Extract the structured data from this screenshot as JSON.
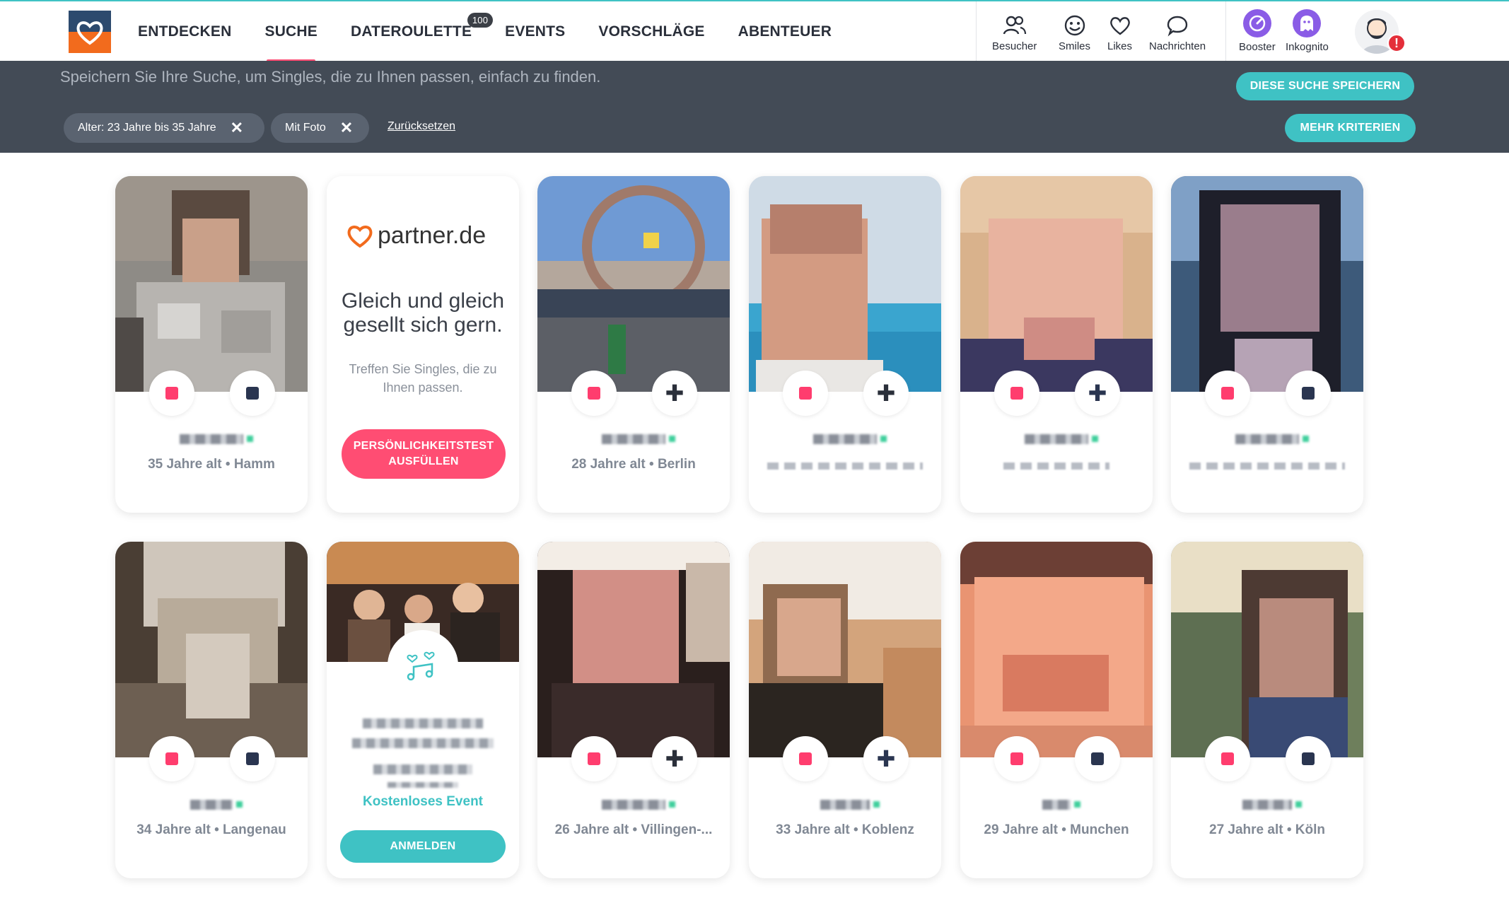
{
  "nav": {
    "items": [
      {
        "label": "ENTDECKEN"
      },
      {
        "label": "SUCHE",
        "active": true
      },
      {
        "label": "DATEROULETTE",
        "badge": "100"
      },
      {
        "label": "EVENTS"
      },
      {
        "label": "VORSCHLÄGE"
      },
      {
        "label": "ABENTEUER"
      }
    ],
    "icons": [
      {
        "label": "Besucher",
        "icon": "visitors-icon"
      },
      {
        "label": "Smiles",
        "icon": "smile-icon"
      },
      {
        "label": "Likes",
        "icon": "heart-outline-icon"
      },
      {
        "label": "Nachrichten",
        "icon": "chat-bubble-icon"
      },
      {
        "label": "Booster",
        "icon": "booster-icon"
      },
      {
        "label": "Inkognito",
        "icon": "ghost-icon"
      }
    ],
    "alert": "!"
  },
  "search": {
    "hint": "Speichern Sie Ihre Suche, um Singles, die zu Ihnen passen, einfach zu finden.",
    "save_label": "DIESE SUCHE SPEICHERN",
    "more_label": "MEHR KRITERIEN",
    "chips": [
      {
        "label": "Alter: 23 Jahre bis 35 Jahre"
      },
      {
        "label": "Mit Foto"
      }
    ],
    "reset_label": "Zurücksetzen"
  },
  "promo": {
    "logo_text": "partner.de",
    "title": "Gleich und gleich gesellt sich gern.",
    "subtitle": "Treffen Sie Singles, die zu Ihnen passen.",
    "button": "PERSÖNLICHKEITSTEST AUSFÜLLEN"
  },
  "event": {
    "free_label": "Kostenloses Event",
    "button": "ANMELDEN"
  },
  "profiles": [
    {
      "location": "35 Jahre alt • Hamm"
    },
    {
      "location": "28 Jahre alt • Berlin"
    },
    {
      "location": ""
    },
    {
      "location": ""
    },
    {
      "location": ""
    },
    {
      "location": "34 Jahre alt • Langenau"
    },
    {
      "location": "26 Jahre alt • Villingen-..."
    },
    {
      "location": "33 Jahre alt • Koblenz"
    },
    {
      "location": "29 Jahre alt • Munchen"
    },
    {
      "location": "27 Jahre alt • Köln"
    }
  ],
  "colors": {
    "accent": "#3fc2c4",
    "pink": "#ff4d73",
    "searchbar": "#434b56",
    "chip": "#5a6370",
    "booster": "#8a5ce6",
    "alert": "#e42f3a",
    "logo_top": "#2d4a6e",
    "logo_bottom": "#f26b1d"
  }
}
